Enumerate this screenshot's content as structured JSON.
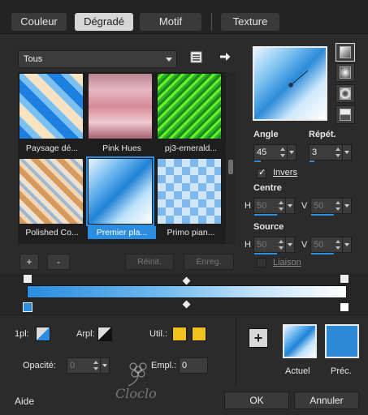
{
  "tabs": [
    {
      "label": "Couleur"
    },
    {
      "label": "Dégradé"
    },
    {
      "label": "Motif"
    },
    {
      "label": "Texture"
    }
  ],
  "gradient_list": {
    "filter_value": "Tous",
    "items": [
      {
        "label": "Paysage dé..."
      },
      {
        "label": "Pink Hues"
      },
      {
        "label": "pj3-emerald..."
      },
      {
        "label": "Polished Co..."
      },
      {
        "label": "Premier pla...",
        "selected": true
      },
      {
        "label": "Primo pian..."
      }
    ],
    "add_label": "+",
    "remove_label": "-",
    "reset_label": "Réinit.",
    "save_label": "Enreg."
  },
  "settings": {
    "angle_label": "Angle",
    "angle_value": "45",
    "repeat_label": "Répét.",
    "repeat_value": "3",
    "invert_label": "Invers",
    "invert_checked": true,
    "center_label": "Centre",
    "center_h_label": "H",
    "center_h_value": "50",
    "center_v_label": "V",
    "center_v_value": "50",
    "source_label": "Source",
    "source_h_label": "H",
    "source_h_value": "50",
    "source_v_label": "V",
    "source_v_value": "50",
    "link_label": "Liaison"
  },
  "editor": {
    "location_label": "1pl:",
    "arpl_label": "Arpl:",
    "util_label": "Util.:",
    "opacity_label": "Opacité:",
    "opacity_value": "0",
    "empl_label": "Empl.:",
    "empl_value": "0"
  },
  "colors_panel": {
    "current_label": "Actuel",
    "previous_label": "Préc."
  },
  "footer": {
    "help_label": "Aide",
    "ok_label": "OK",
    "cancel_label": "Annuler",
    "watermark": "Cloclo"
  },
  "colors": {
    "accent": "#2a8ddf",
    "util_yellow": "#f1c21b",
    "prev_color": "#2d8ad6"
  }
}
